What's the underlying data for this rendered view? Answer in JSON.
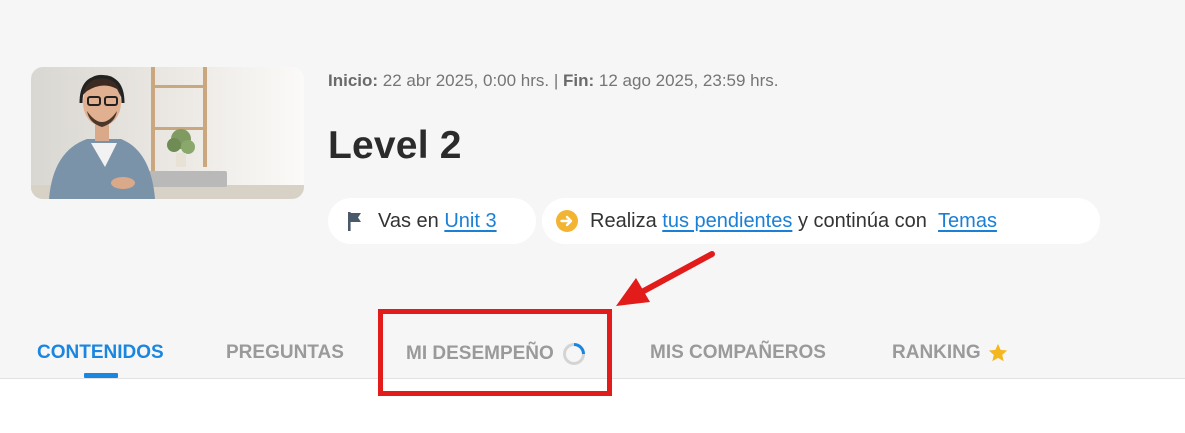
{
  "course": {
    "dates": {
      "start_label": "Inicio:",
      "start_value": "22 abr 2025, 0:00 hrs.",
      "separator": "|",
      "end_label": "Fin:",
      "end_value": "12 ago 2025, 23:59 hrs."
    },
    "title": "Level 2",
    "image_alt": "course-cover-photo"
  },
  "progress_pill": {
    "icon": "flag-icon",
    "prefix": "Vas en",
    "unit_link": "Unit 3"
  },
  "pending_pill": {
    "icon": "arrow-right-circle-icon",
    "prefix": "Realiza",
    "pending_link": "tus pendientes",
    "middle": "y continúa con",
    "topics_link": "Temas"
  },
  "tabs": [
    {
      "label": "CONTENIDOS",
      "active": true
    },
    {
      "label": "PREGUNTAS",
      "active": false
    },
    {
      "label": "MI DESEMPEÑO",
      "active": false,
      "icon": "loading-spinner-icon"
    },
    {
      "label": "MIS COMPAÑEROS",
      "active": false
    },
    {
      "label": "RANKING",
      "active": false,
      "icon": "star-icon"
    }
  ],
  "colors": {
    "accent": "#1a86e0",
    "link": "#1a7fd6",
    "annotation": "#e21b1b",
    "star": "#f5b71f",
    "pending_icon": "#f2b431"
  }
}
